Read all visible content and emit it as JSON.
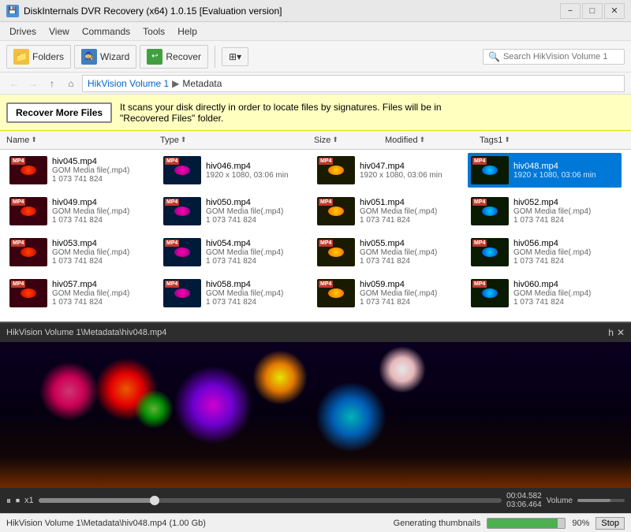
{
  "titlebar": {
    "title": "DiskInternals DVR Recovery (x64) 1.0.15 [Evaluation version]",
    "icon": "💾",
    "min_label": "−",
    "max_label": "□",
    "close_label": "✕"
  },
  "menubar": {
    "items": [
      "Drives",
      "View",
      "Commands",
      "Tools",
      "Help"
    ]
  },
  "toolbar": {
    "folders_label": "Folders",
    "wizard_label": "Wizard",
    "recover_label": "Recover",
    "search_placeholder": "Search HikVision Volume 1"
  },
  "addressbar": {
    "back_label": "←",
    "forward_label": "→",
    "up_label": "↑",
    "history_label": "⌂",
    "breadcrumb_root": "HikVision Volume 1",
    "breadcrumb_sep": "▶",
    "breadcrumb_current": "Metadata"
  },
  "banner": {
    "button_label": "Recover More Files",
    "text_line1": "It scans your disk directly in order to locate files by signatures. Files will be in",
    "text_line2": "\"Recovered Files\" folder."
  },
  "columns": {
    "name": "Name",
    "type": "Type",
    "size": "Size",
    "modified": "Modified",
    "tags": "Tags1"
  },
  "files": [
    {
      "name": "hiv045.mp4",
      "meta1": "GOM Media file(.mp4)",
      "meta2": "1 073 741 824",
      "selected": false
    },
    {
      "name": "hiv046.mp4",
      "meta1": "1920 x 1080, 03:06 min",
      "meta2": "",
      "selected": false
    },
    {
      "name": "hiv047.mp4",
      "meta1": "1920 x 1080, 03:06 min",
      "meta2": "",
      "selected": false
    },
    {
      "name": "hiv048.mp4",
      "meta1": "1920 x 1080, 03:06 min",
      "meta2": "",
      "selected": true
    },
    {
      "name": "hiv049.mp4",
      "meta1": "GOM Media file(.mp4)",
      "meta2": "1 073 741 824",
      "selected": false
    },
    {
      "name": "hiv050.mp4",
      "meta1": "GOM Media file(.mp4)",
      "meta2": "1 073 741 824",
      "selected": false
    },
    {
      "name": "hiv051.mp4",
      "meta1": "GOM Media file(.mp4)",
      "meta2": "1 073 741 824",
      "selected": false
    },
    {
      "name": "hiv052.mp4",
      "meta1": "GOM Media file(.mp4)",
      "meta2": "1 073 741 824",
      "selected": false
    },
    {
      "name": "hiv053.mp4",
      "meta1": "GOM Media file(.mp4)",
      "meta2": "1 073 741 824",
      "selected": false
    },
    {
      "name": "hiv054.mp4",
      "meta1": "GOM Media file(.mp4)",
      "meta2": "1 073 741 824",
      "selected": false
    },
    {
      "name": "hiv055.mp4",
      "meta1": "GOM Media file(.mp4)",
      "meta2": "1 073 741 824",
      "selected": false
    },
    {
      "name": "hiv056.mp4",
      "meta1": "GOM Media file(.mp4)",
      "meta2": "1 073 741 824",
      "selected": false
    },
    {
      "name": "hiv057.mp4",
      "meta1": "GOM Media file(.mp4)",
      "meta2": "1 073 741 824",
      "selected": false
    },
    {
      "name": "hiv058.mp4",
      "meta1": "GOM Media file(.mp4)",
      "meta2": "1 073 741 824",
      "selected": false
    },
    {
      "name": "hiv059.mp4",
      "meta1": "GOM Media file(.mp4)",
      "meta2": "1 073 741 824",
      "selected": false
    },
    {
      "name": "hiv060.mp4",
      "meta1": "GOM Media file(.mp4)",
      "meta2": "1 073 741 824",
      "selected": false
    }
  ],
  "preview": {
    "path": "HikVision Volume 1\\Metadata\\hiv048.mp4",
    "hint_label": "h",
    "close_label": "✕",
    "time_current": "00:04.582",
    "time_total": "03:06.464",
    "volume_label": "Volume",
    "speed_label": "x1"
  },
  "statusbar": {
    "path": "HikVision Volume 1\\Metadata\\hiv048.mp4 (1.00 Gb)",
    "gen_label": "Generating thumbnails",
    "progress_pct": "90%",
    "stop_label": "Stop"
  }
}
